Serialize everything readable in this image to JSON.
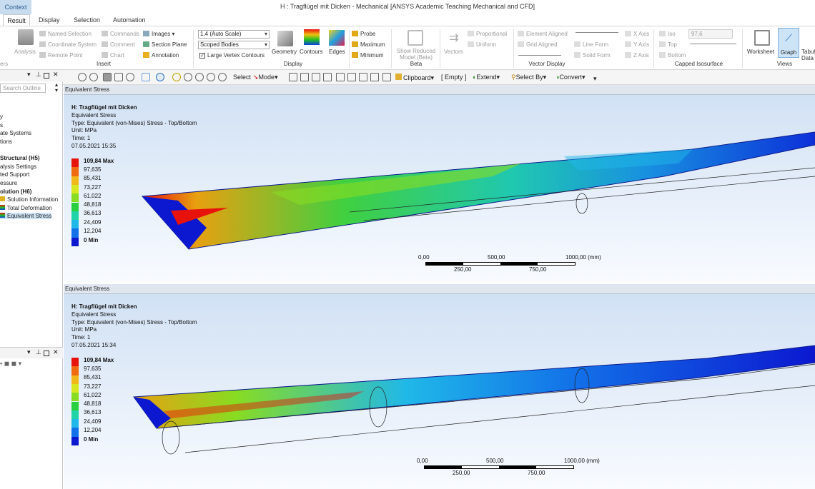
{
  "window": {
    "context_tab": "Context",
    "title": "H : Tragflügel mit Dicken - Mechanical [ANSYS Academic Teaching Mechanical and CFD]"
  },
  "tabs": [
    "Result",
    "Display",
    "Selection",
    "Automation"
  ],
  "ribbon": {
    "insert": {
      "named_selection": "Named Selection",
      "coordinate_system": "Coordinate System",
      "remote_point": "Remote Point",
      "commands": "Commands",
      "comment": "Comment",
      "chart": "Chart",
      "images": "Images",
      "section_plane": "Section Plane",
      "annotation": "Annotation",
      "analysis": "Analysis",
      "group_label": "Insert",
      "cut_label": "ers"
    },
    "display": {
      "scale": "1,4 (Auto Scale)",
      "bodies": "Scoped Bodies",
      "large_vertex": "Large Vertex Contours",
      "geometry": "Geometry",
      "contours": "Contours",
      "edges": "Edges",
      "group_label": "Display"
    },
    "probe": {
      "probe": "Probe",
      "maximum": "Maximum",
      "minimum": "Minimum"
    },
    "beta": {
      "show_reduced": "Show Reduced Model (Beta)",
      "group_label": "Beta"
    },
    "vector": {
      "vectors": "Vectors",
      "proportional": "Proportional",
      "uniform": "Uniform",
      "element_aligned": "Element Aligned",
      "grid_aligned": "Grid Aligned",
      "line_form": "Line Form",
      "solid_form": "Solid Form",
      "x_axis": "X Axis",
      "y_axis": "Y Axis",
      "z_axis": "Z Axis",
      "group_label": "Vector Display"
    },
    "iso": {
      "iso": "Iso",
      "top": "Top",
      "bottom": "Bottom",
      "value": "97,6",
      "group_label": "Capped Isosurface"
    },
    "views": {
      "worksheet": "Worksheet",
      "graph": "Graph",
      "tabular": "Tabul Data",
      "group_label": "Views"
    }
  },
  "toolbar": {
    "select": "Select",
    "mode": "Mode",
    "clipboard": "Clipboard",
    "empty": "[ Empty ]",
    "extend": "Extend",
    "select_by": "Select By",
    "convert": "Convert"
  },
  "outline": {
    "search_placeholder": "Search Outline",
    "items": [
      "y",
      "s",
      "ate Systems",
      "tions",
      "Structural (H5)",
      "alysis Settings",
      "ted Support",
      "essure",
      "olution (H6)",
      "Solution Information",
      "Total Deformation",
      "Equivalent Stress"
    ]
  },
  "views": [
    {
      "header": "Equivalent Stress",
      "title": "H: Tragflügel mit Dicken",
      "line1": "Equivalent Stress",
      "line2": "Type: Equivalent (von-Mises) Stress - Top/Bottom",
      "line3": "Unit: MPa",
      "line4": "Time: 1",
      "line5": "07.05.2021 15:35"
    },
    {
      "header": "Equivalent Stress",
      "title": "H: Tragflügel mit Dicken",
      "line1": "Equivalent Stress",
      "line2": "Type: Equivalent (von-Mises) Stress - Top/Bottom",
      "line3": "Unit: MPa",
      "line4": "Time: 1",
      "line5": "07.05.2021 15:34"
    }
  ],
  "legend": {
    "labels": [
      "109,84 Max",
      "97,635",
      "85,431",
      "73,227",
      "61,022",
      "48,818",
      "36,613",
      "24,409",
      "12,204",
      "0 Min"
    ],
    "colors": [
      "#e8120c",
      "#f06a10",
      "#f0b818",
      "#d8e820",
      "#88dc22",
      "#28d040",
      "#20d4a8",
      "#20b8e8",
      "#1270e8",
      "#0c18d0"
    ]
  },
  "scalebar": {
    "top": [
      "0,00",
      "500,00",
      "1000,00 (mm)"
    ],
    "bottom": [
      "250,00",
      "750,00"
    ]
  }
}
